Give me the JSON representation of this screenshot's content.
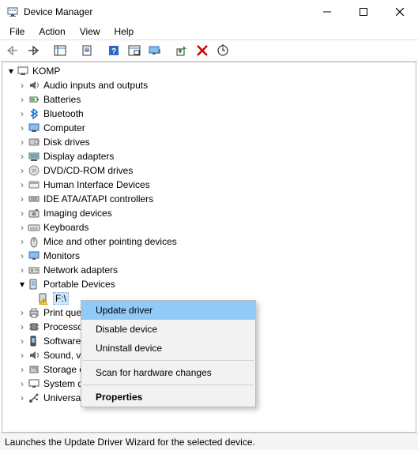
{
  "window": {
    "title": "Device Manager"
  },
  "menubar": [
    "File",
    "Action",
    "View",
    "Help"
  ],
  "tree": {
    "root": "KOMP",
    "categories": [
      "Audio inputs and outputs",
      "Batteries",
      "Bluetooth",
      "Computer",
      "Disk drives",
      "Display adapters",
      "DVD/CD-ROM drives",
      "Human Interface Devices",
      "IDE ATA/ATAPI controllers",
      "Imaging devices",
      "Keyboards",
      "Mice and other pointing devices",
      "Monitors",
      "Network adapters",
      "Portable Devices",
      "Print queues",
      "Processors",
      "Software devices",
      "Sound, video and game controllers",
      "Storage controllers",
      "System devices",
      "Universal Serial Bus controllers"
    ],
    "expanded_category_index": 14,
    "selected_device": "F:\\"
  },
  "context_menu": {
    "items": [
      "Update driver",
      "Disable device",
      "Uninstall device",
      "Scan for hardware changes",
      "Properties"
    ],
    "highlighted_index": 0
  },
  "statusbar": {
    "text": "Launches the Update Driver Wizard for the selected device."
  }
}
